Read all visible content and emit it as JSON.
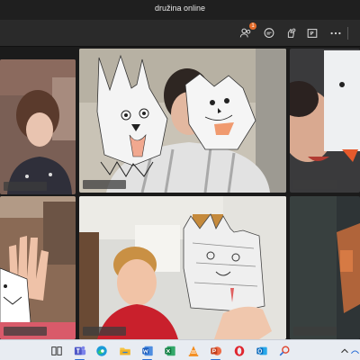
{
  "window": {
    "title": "družina online"
  },
  "toolbar": {
    "participants_badge": "1",
    "icons": [
      "people-icon",
      "chat-icon",
      "reactions-icon",
      "share-screen-icon",
      "more-icon"
    ]
  },
  "taskbar": {
    "apps": [
      "task-view-icon",
      "teams-icon",
      "edge-icon",
      "file-explorer-icon",
      "word-icon",
      "excel-icon",
      "vlc-icon",
      "powerpoint-icon",
      "opera-icon",
      "outlook-icon",
      "search-app-icon"
    ],
    "tray": [
      "chevron-up-icon",
      "network-icon"
    ]
  },
  "colors": {
    "accent": "#6264a7",
    "badge": "#e36c2b",
    "titlebar": "#1f1f1f",
    "toolbar": "#2a2a2a",
    "taskbar": "#e8ecf2"
  }
}
